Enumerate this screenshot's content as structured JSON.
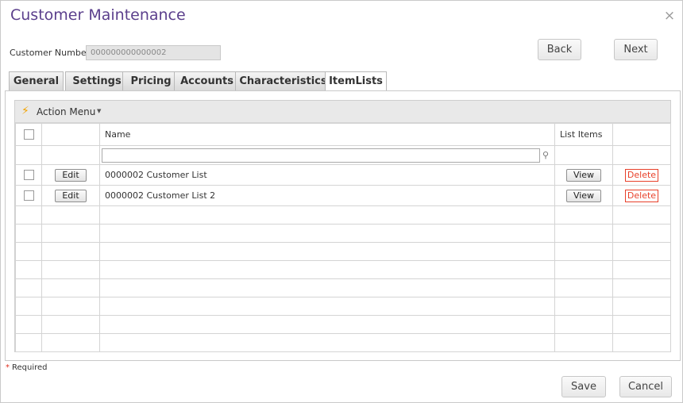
{
  "dialog": {
    "title": "Customer Maintenance",
    "close_glyph": "×"
  },
  "customer": {
    "label": "Customer Number:",
    "value": "000000000000002"
  },
  "nav": {
    "back_label": "Back",
    "next_label": "Next"
  },
  "tabs": [
    {
      "label": "General",
      "active": false
    },
    {
      "label": "Settings",
      "active": false
    },
    {
      "label": "Pricing",
      "active": false
    },
    {
      "label": "Accounts",
      "active": false
    },
    {
      "label": "Characteristics",
      "active": false
    },
    {
      "label": "ItemLists",
      "active": true
    }
  ],
  "grid": {
    "action_menu_label": "Action Menu",
    "action_icon": "lightning-bolt-icon",
    "columns": {
      "name": "Name",
      "list_items": "List Items"
    },
    "rows": [
      {
        "edit_label": "Edit",
        "name": "0000002 Customer List",
        "view_label": "View",
        "delete_label": "Delete"
      },
      {
        "edit_label": "Edit",
        "name": "0000002 Customer List 2",
        "view_label": "View",
        "delete_label": "Delete"
      }
    ]
  },
  "footer": {
    "required_star": "*",
    "required_label": "Required",
    "save_label": "Save",
    "cancel_label": "Cancel"
  },
  "colors": {
    "title": "#5b3f8c",
    "delete": "#e8402a",
    "bolt": "#f2a300"
  }
}
